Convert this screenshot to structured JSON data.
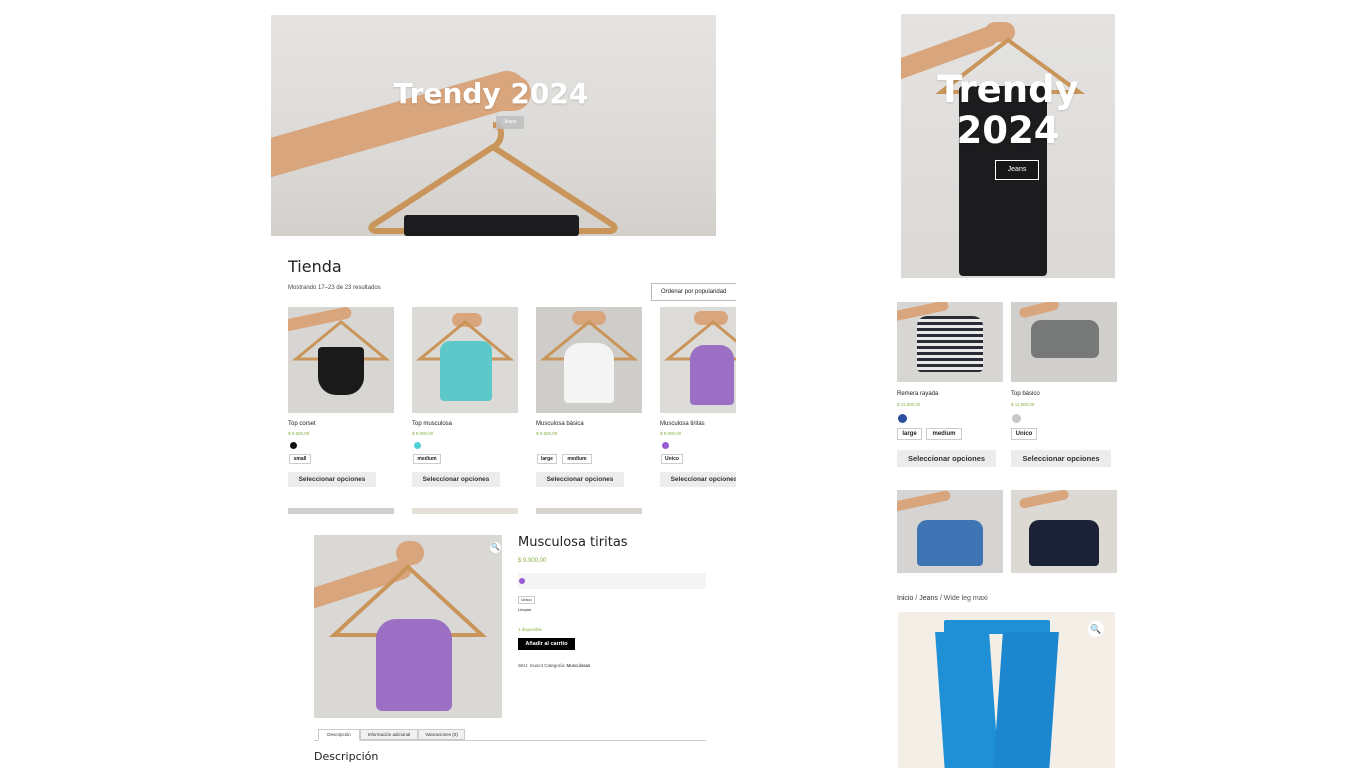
{
  "left_hero": {
    "title": "Trendy 2024",
    "button": "Jeans"
  },
  "shop": {
    "title": "Tienda",
    "result_count": "Mostrando 17–23 de 23 resultados",
    "sort_label": "Ordenar por popularidad",
    "products": [
      {
        "name": "Top corset",
        "price": "$ 9.900,00",
        "swatch": "#111111",
        "sizes": [
          "small"
        ],
        "button": "Seleccionar opciones",
        "garment_color": "#1a1a1a"
      },
      {
        "name": "Top musculosa",
        "price": "$ 9.900,00",
        "swatch": "#4fd1d6",
        "sizes": [
          "medium"
        ],
        "button": "Seleccionar opciones",
        "garment_color": "#5cc8c9"
      },
      {
        "name": "Musculosa básica",
        "price": "$ 9.900,00",
        "swatch": "#ffffff",
        "sizes": [
          "large",
          "medium"
        ],
        "button": "Seleccionar opciones",
        "garment_color": "#f4f4f4"
      },
      {
        "name": "Musculosa tiritas",
        "price": "$ 9.900,00",
        "swatch": "#9b5bd4",
        "sizes": [
          "Unico"
        ],
        "button": "Seleccionar opciones",
        "garment_color": "#9a6fc4"
      }
    ]
  },
  "product_detail": {
    "title": "Musculosa tiritas",
    "price": "$ 9.900,00",
    "swatch": "#9b5bd4",
    "size": "Unico",
    "clear": "Limpiar",
    "stock": "1 disponible",
    "add_to_cart": "Añadir al carrito",
    "meta_prefix": "SKU: musc4 Categoría:",
    "meta_category": "Musculosas",
    "tabs": [
      "Descripción",
      "Información adicional",
      "Valoraciones (0)"
    ],
    "section_heading": "Descripción",
    "zoom_icon": "magnifier-icon"
  },
  "right_hero": {
    "title_line1": "Trendy",
    "title_line2": "2024",
    "button": "Jeans"
  },
  "right_products": [
    {
      "name": "Remera rayada",
      "price": "$ 11.500,00",
      "swatch": "#2b4ea0",
      "sizes": [
        "large",
        "medium"
      ],
      "button": "Seleccionar opciones"
    },
    {
      "name": "Top básico",
      "price": "$ 11.900,00",
      "swatch": "#c8c8c8",
      "sizes": [
        "Unico"
      ],
      "button": "Seleccionar opciones"
    }
  ],
  "breadcrumb": {
    "home": "Inicio",
    "sep1": " / ",
    "cat": "Jeans",
    "sep2": " / ",
    "current": "Wide leg maxi"
  },
  "colors": {
    "accent_price": "#8bb04a",
    "button_bg": "#ececec",
    "cart_btn": "#000000",
    "jeans_blue": "#1f8fd6"
  }
}
